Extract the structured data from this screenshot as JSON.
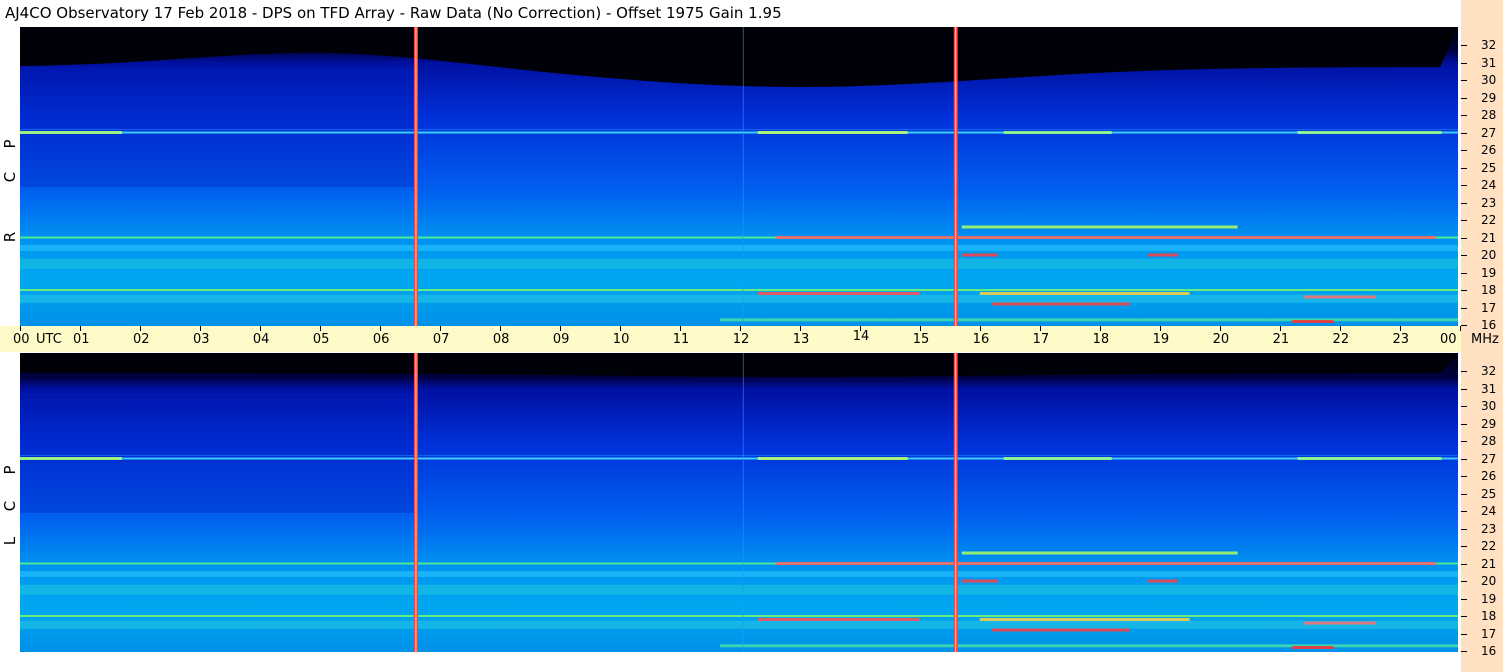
{
  "title": "AJ4CO Observatory  17 Feb 2018  -  DPS on TFD Array  -  Raw Data (No Correction)  -  Offset 1975  Gain 1.95",
  "polarizations": [
    {
      "letters": [
        "R",
        "C",
        "P"
      ]
    },
    {
      "letters": [
        "L",
        "C",
        "P"
      ]
    }
  ],
  "time_axis": {
    "labels": [
      "00",
      "01",
      "02",
      "03",
      "04",
      "05",
      "06",
      "07",
      "08",
      "09",
      "10",
      "11",
      "12",
      "13",
      "14",
      "15",
      "16",
      "17",
      "18",
      "19",
      "20",
      "21",
      "22",
      "23",
      "00"
    ],
    "utc_label": "UTC",
    "unit_label": "MHz"
  },
  "colors": {
    "background_band": "#0000cc",
    "axis_band": "#fffbc8",
    "freq_strip": "#ffe0c0",
    "interference": "#ff3030"
  },
  "chart_data": {
    "type": "heatmap",
    "title": "AJ4CO Observatory  17 Feb 2018  -  DPS on TFD Array  -  Raw Data (No Correction)  -  Offset 1975  Gain 1.95",
    "xlabel": "UTC",
    "ylabel": "MHz",
    "x_range": [
      0,
      24
    ],
    "y_range": [
      16,
      32
    ],
    "x_ticks": [
      "00",
      "01",
      "02",
      "03",
      "04",
      "05",
      "06",
      "07",
      "08",
      "09",
      "10",
      "11",
      "12",
      "13",
      "14",
      "15",
      "16",
      "17",
      "18",
      "19",
      "20",
      "21",
      "22",
      "23",
      "00"
    ],
    "y_ticks": [
      16,
      17,
      18,
      19,
      20,
      21,
      22,
      23,
      24,
      25,
      26,
      27,
      28,
      29,
      30,
      31,
      32
    ],
    "panels": [
      "RCP",
      "LCP"
    ],
    "colormap": "jet",
    "interference_lines_utc": [
      6.6,
      15.6
    ],
    "bright_bands_mhz": [
      27,
      21,
      20,
      18,
      17
    ]
  }
}
